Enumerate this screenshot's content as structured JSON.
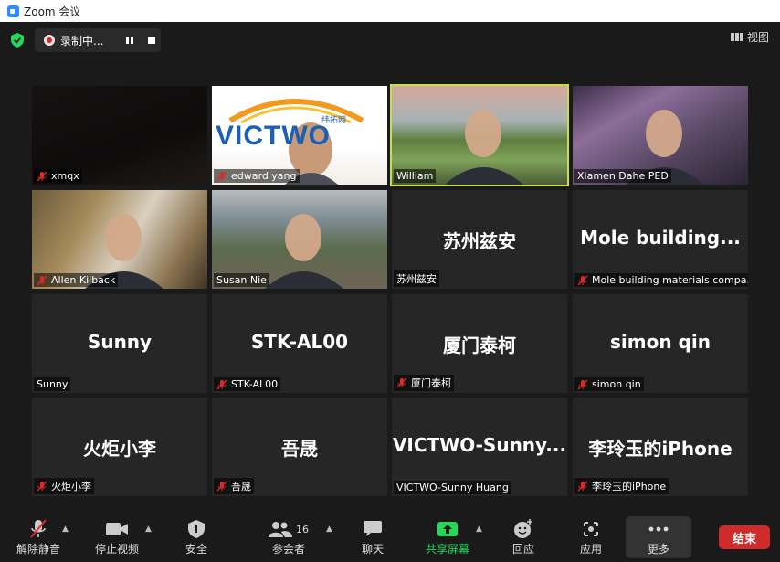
{
  "window": {
    "title": "Zoom 会议"
  },
  "top": {
    "recording_label": "录制中...",
    "view_label": "视图"
  },
  "tiles": [
    {
      "name": "xmqx",
      "display": "",
      "muted": true,
      "video": true
    },
    {
      "name": "edward yang",
      "display": "",
      "muted": true,
      "video": true,
      "banner": "VICTWO",
      "banner_cn": "纬拓网"
    },
    {
      "name": "William",
      "display": "",
      "muted": false,
      "video": true,
      "active": true
    },
    {
      "name": "Xiamen Dahe PED",
      "display": "",
      "muted": false,
      "video": true
    },
    {
      "name": "Allen Kilback",
      "display": "",
      "muted": true,
      "video": true
    },
    {
      "name": "Susan Nie",
      "display": "",
      "muted": false,
      "video": true
    },
    {
      "name": "苏州兹安",
      "display": "苏州兹安",
      "muted": false,
      "video": false
    },
    {
      "name": "Mole building materials compa...",
      "display": "Mole building...",
      "muted": true,
      "video": false
    },
    {
      "name": "Sunny",
      "display": "Sunny",
      "muted": false,
      "video": false
    },
    {
      "name": "STK-AL00",
      "display": "STK-AL00",
      "muted": true,
      "video": false
    },
    {
      "name": "厦门泰柯",
      "display": "厦门泰柯",
      "muted": true,
      "video": false
    },
    {
      "name": "simon qin",
      "display": "simon qin",
      "muted": true,
      "video": false
    },
    {
      "name": "火炬小李",
      "display": "火炬小李",
      "muted": true,
      "video": false
    },
    {
      "name": "吾晟",
      "display": "吾晟",
      "muted": true,
      "video": false
    },
    {
      "name": "VICTWO-Sunny Huang",
      "display": "VICTWO-Sunny...",
      "muted": false,
      "video": false
    },
    {
      "name": "李玲玉的iPhone",
      "display": "李玲玉的iPhone",
      "muted": true,
      "video": false
    }
  ],
  "toolbar": {
    "unmute": "解除静音",
    "stop_video": "停止视频",
    "security": "安全",
    "participants": "参会者",
    "participant_count": "16",
    "chat": "聊天",
    "share": "共享屏幕",
    "reactions": "回应",
    "apps": "应用",
    "more": "更多",
    "end": "结束"
  },
  "colors": {
    "share": "#23d959",
    "end": "#cf2b2b",
    "active_border": "#c6e04a",
    "security": "#23d959"
  }
}
